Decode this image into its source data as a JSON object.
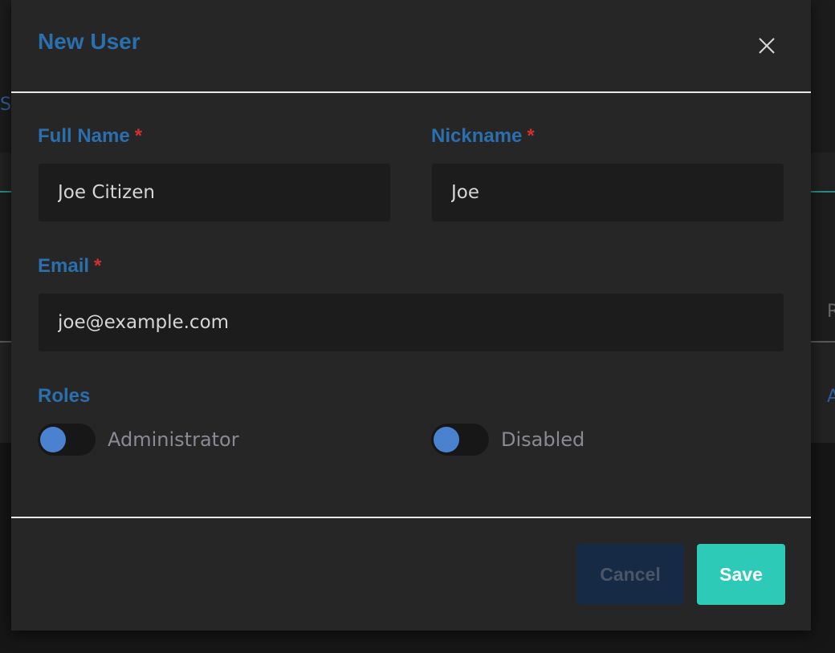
{
  "background": {
    "peek_left": "Sl",
    "peek_right_1": "R",
    "peek_right_2": "A"
  },
  "modal": {
    "title": "New User",
    "close_icon": "close-icon",
    "fields": {
      "full_name": {
        "label": "Full Name",
        "required_mark": "*",
        "value": "Joe Citizen"
      },
      "nickname": {
        "label": "Nickname",
        "required_mark": "*",
        "value": "Joe"
      },
      "email": {
        "label": "Email",
        "required_mark": "*",
        "value": "joe@example.com"
      }
    },
    "roles": {
      "label": "Roles",
      "administrator": {
        "label": "Administrator",
        "on": false
      },
      "disabled": {
        "label": "Disabled",
        "on": false
      }
    },
    "footer": {
      "cancel_label": "Cancel",
      "save_label": "Save"
    }
  },
  "colors": {
    "accent_blue": "#2a6fae",
    "required_red": "#d23030",
    "save_teal": "#2dcab8",
    "cancel_navy": "#172a45",
    "toggle_knob": "#4a82d0"
  }
}
